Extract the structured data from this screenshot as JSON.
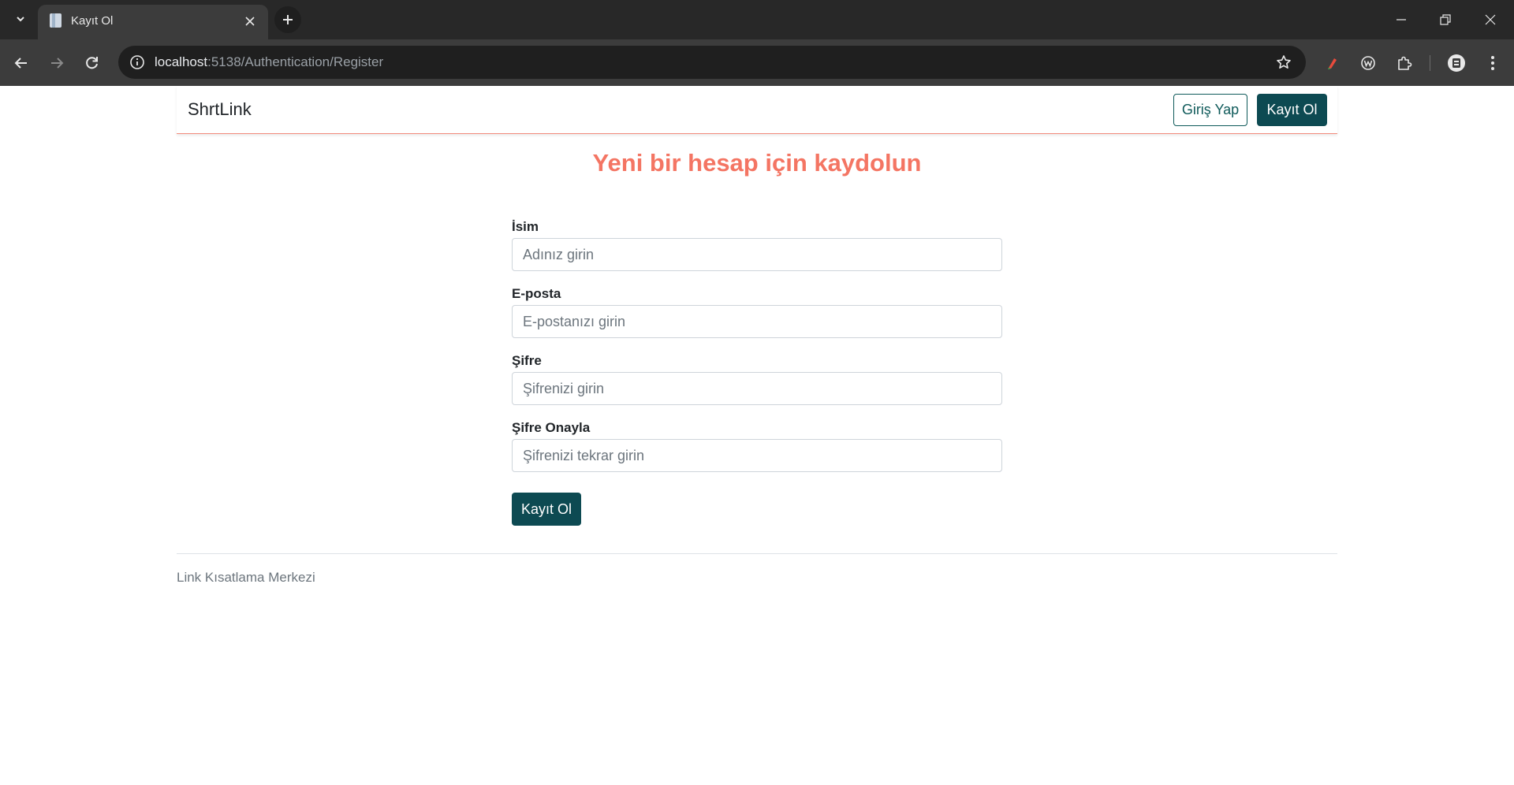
{
  "browser": {
    "tab_title": "Kayıt Ol",
    "url_host": "localhost",
    "url_rest": ":5138/Authentication/Register"
  },
  "navbar": {
    "brand": "ShrtLink",
    "login_label": "Giriş Yap",
    "register_label": "Kayıt Ol"
  },
  "form": {
    "heading": "Yeni bir hesap için kaydolun",
    "name": {
      "label": "İsim",
      "placeholder": "Adınız girin"
    },
    "email": {
      "label": "E-posta",
      "placeholder": "E-postanızı girin"
    },
    "password": {
      "label": "Şifre",
      "placeholder": "Şifrenizi girin"
    },
    "confirm": {
      "label": "Şifre Onayla",
      "placeholder": "Şifrenizi tekrar girin"
    },
    "submit_label": "Kayıt Ol"
  },
  "footer": {
    "text": "Link Kısatlama Merkezi"
  },
  "colors": {
    "accent": "#f47563",
    "primary": "#0d4a52"
  }
}
